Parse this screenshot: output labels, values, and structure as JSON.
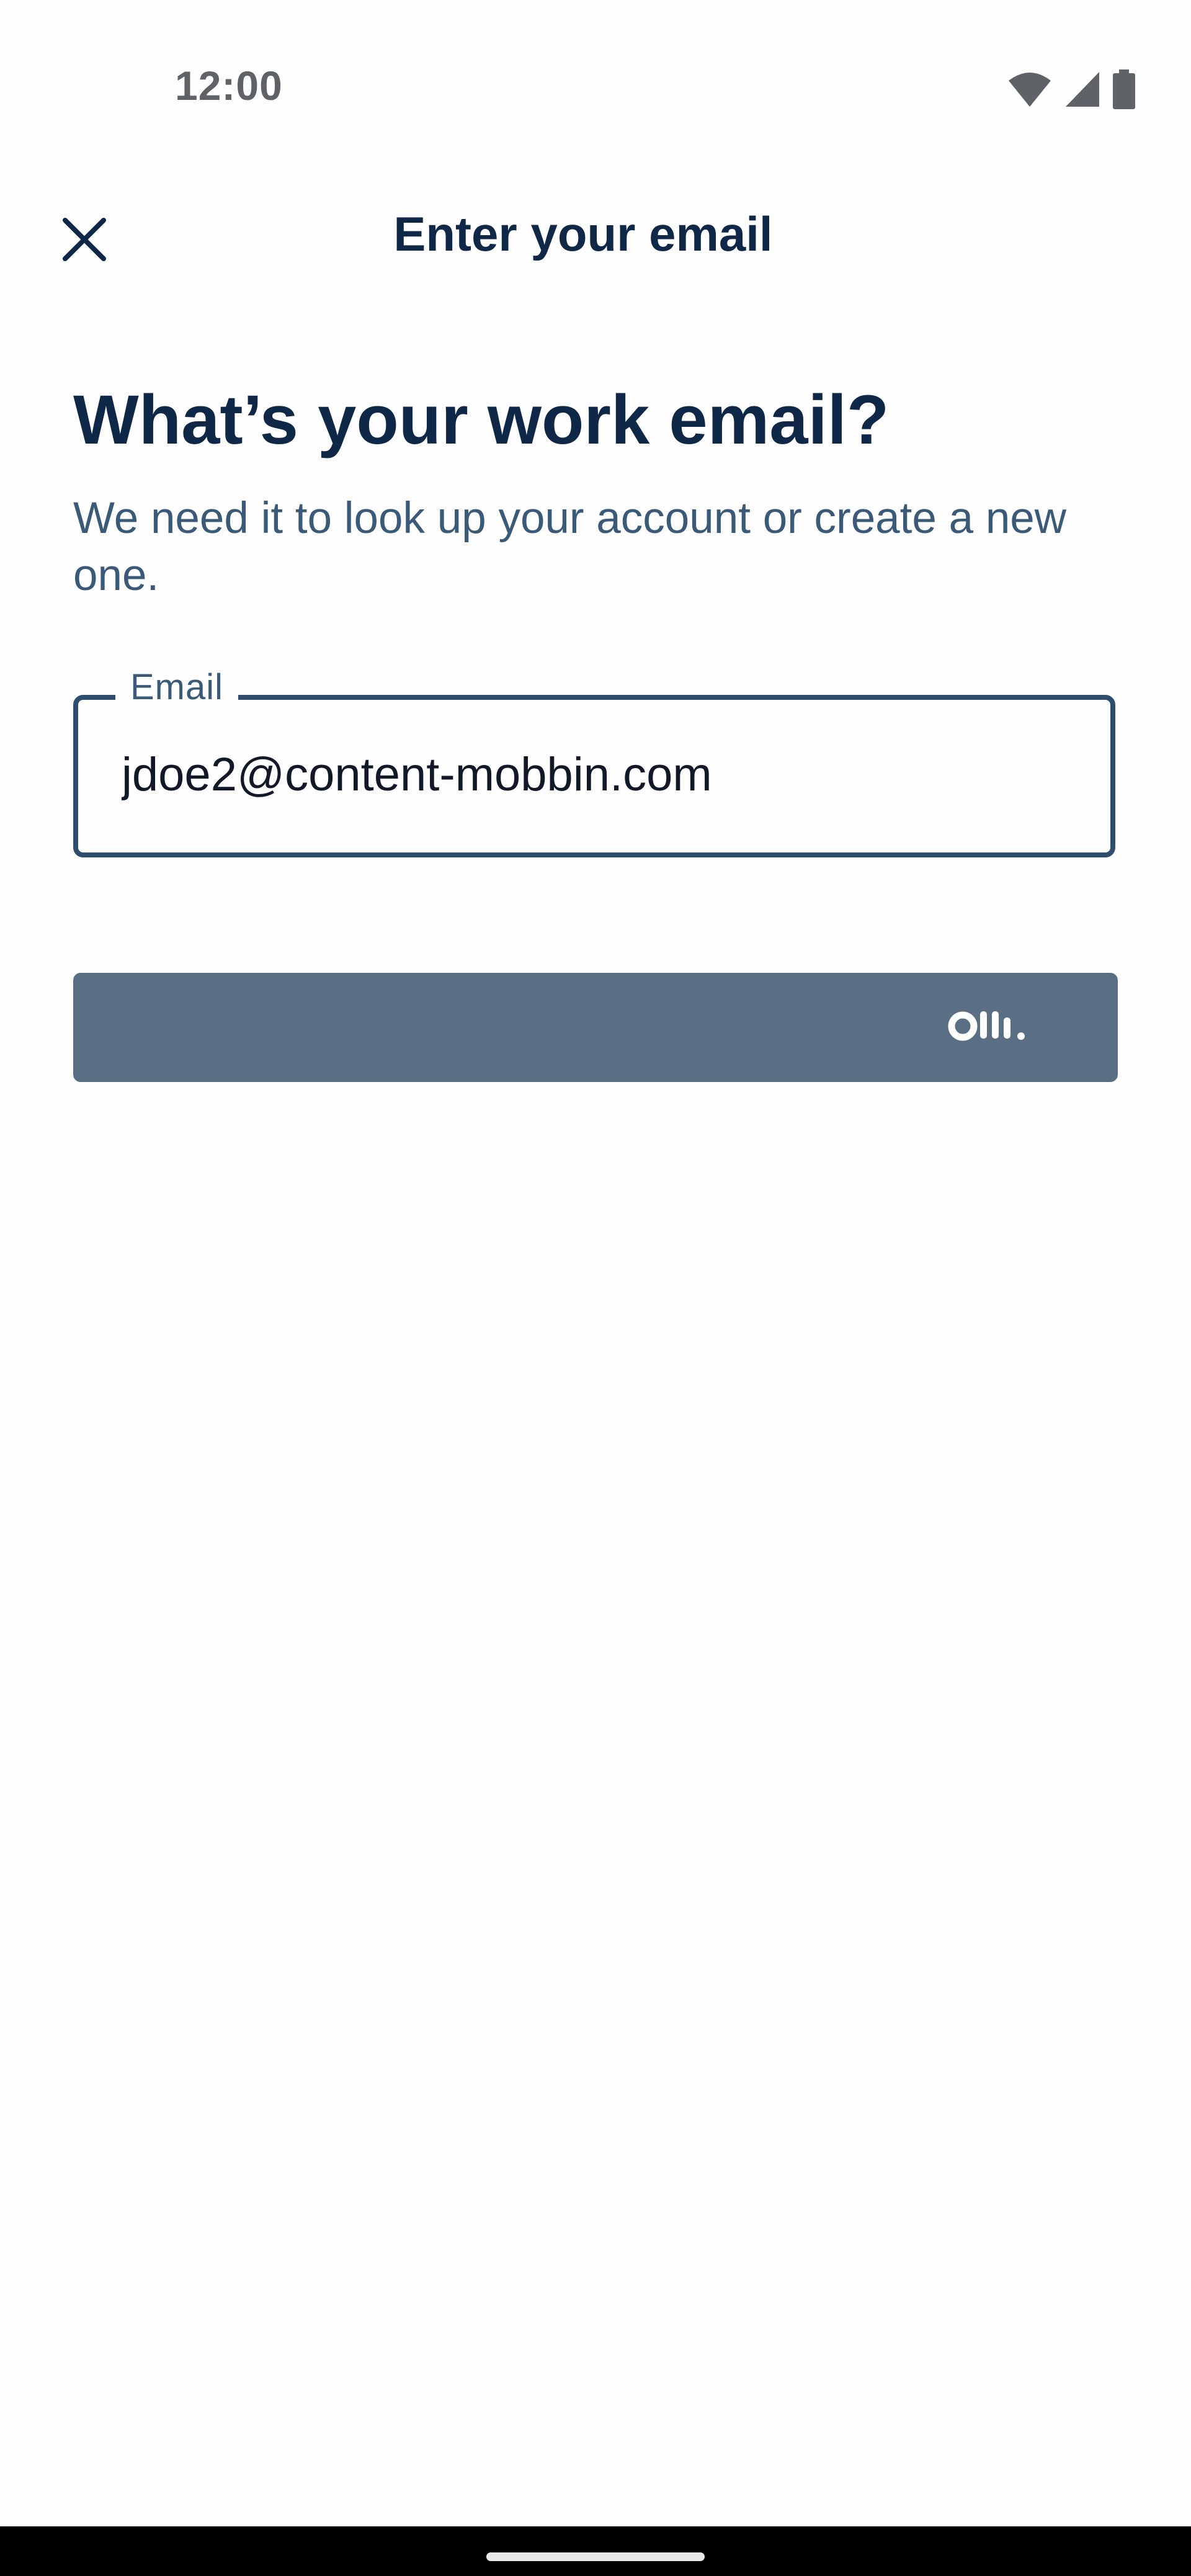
{
  "status_bar": {
    "time": "12:00",
    "icons": [
      "wifi-icon",
      "cellular-signal-icon",
      "battery-icon"
    ]
  },
  "app_bar": {
    "close_icon": "close-icon",
    "title": "Enter your email"
  },
  "main": {
    "heading": "What’s your work email?",
    "subtitle": "We need it to look up your account or create a new one.",
    "email_field": {
      "label": "Email",
      "value": "jdoe2@content-mobbin.com"
    },
    "submit_button": {
      "icon": "otter-loading-logo-icon"
    }
  },
  "colors": {
    "primary_text": "#0f2848",
    "secondary_text": "#3a5a78",
    "field_border": "#2f4d6c",
    "button_bg": "#5a6e84",
    "background": "#fdfdfd"
  }
}
